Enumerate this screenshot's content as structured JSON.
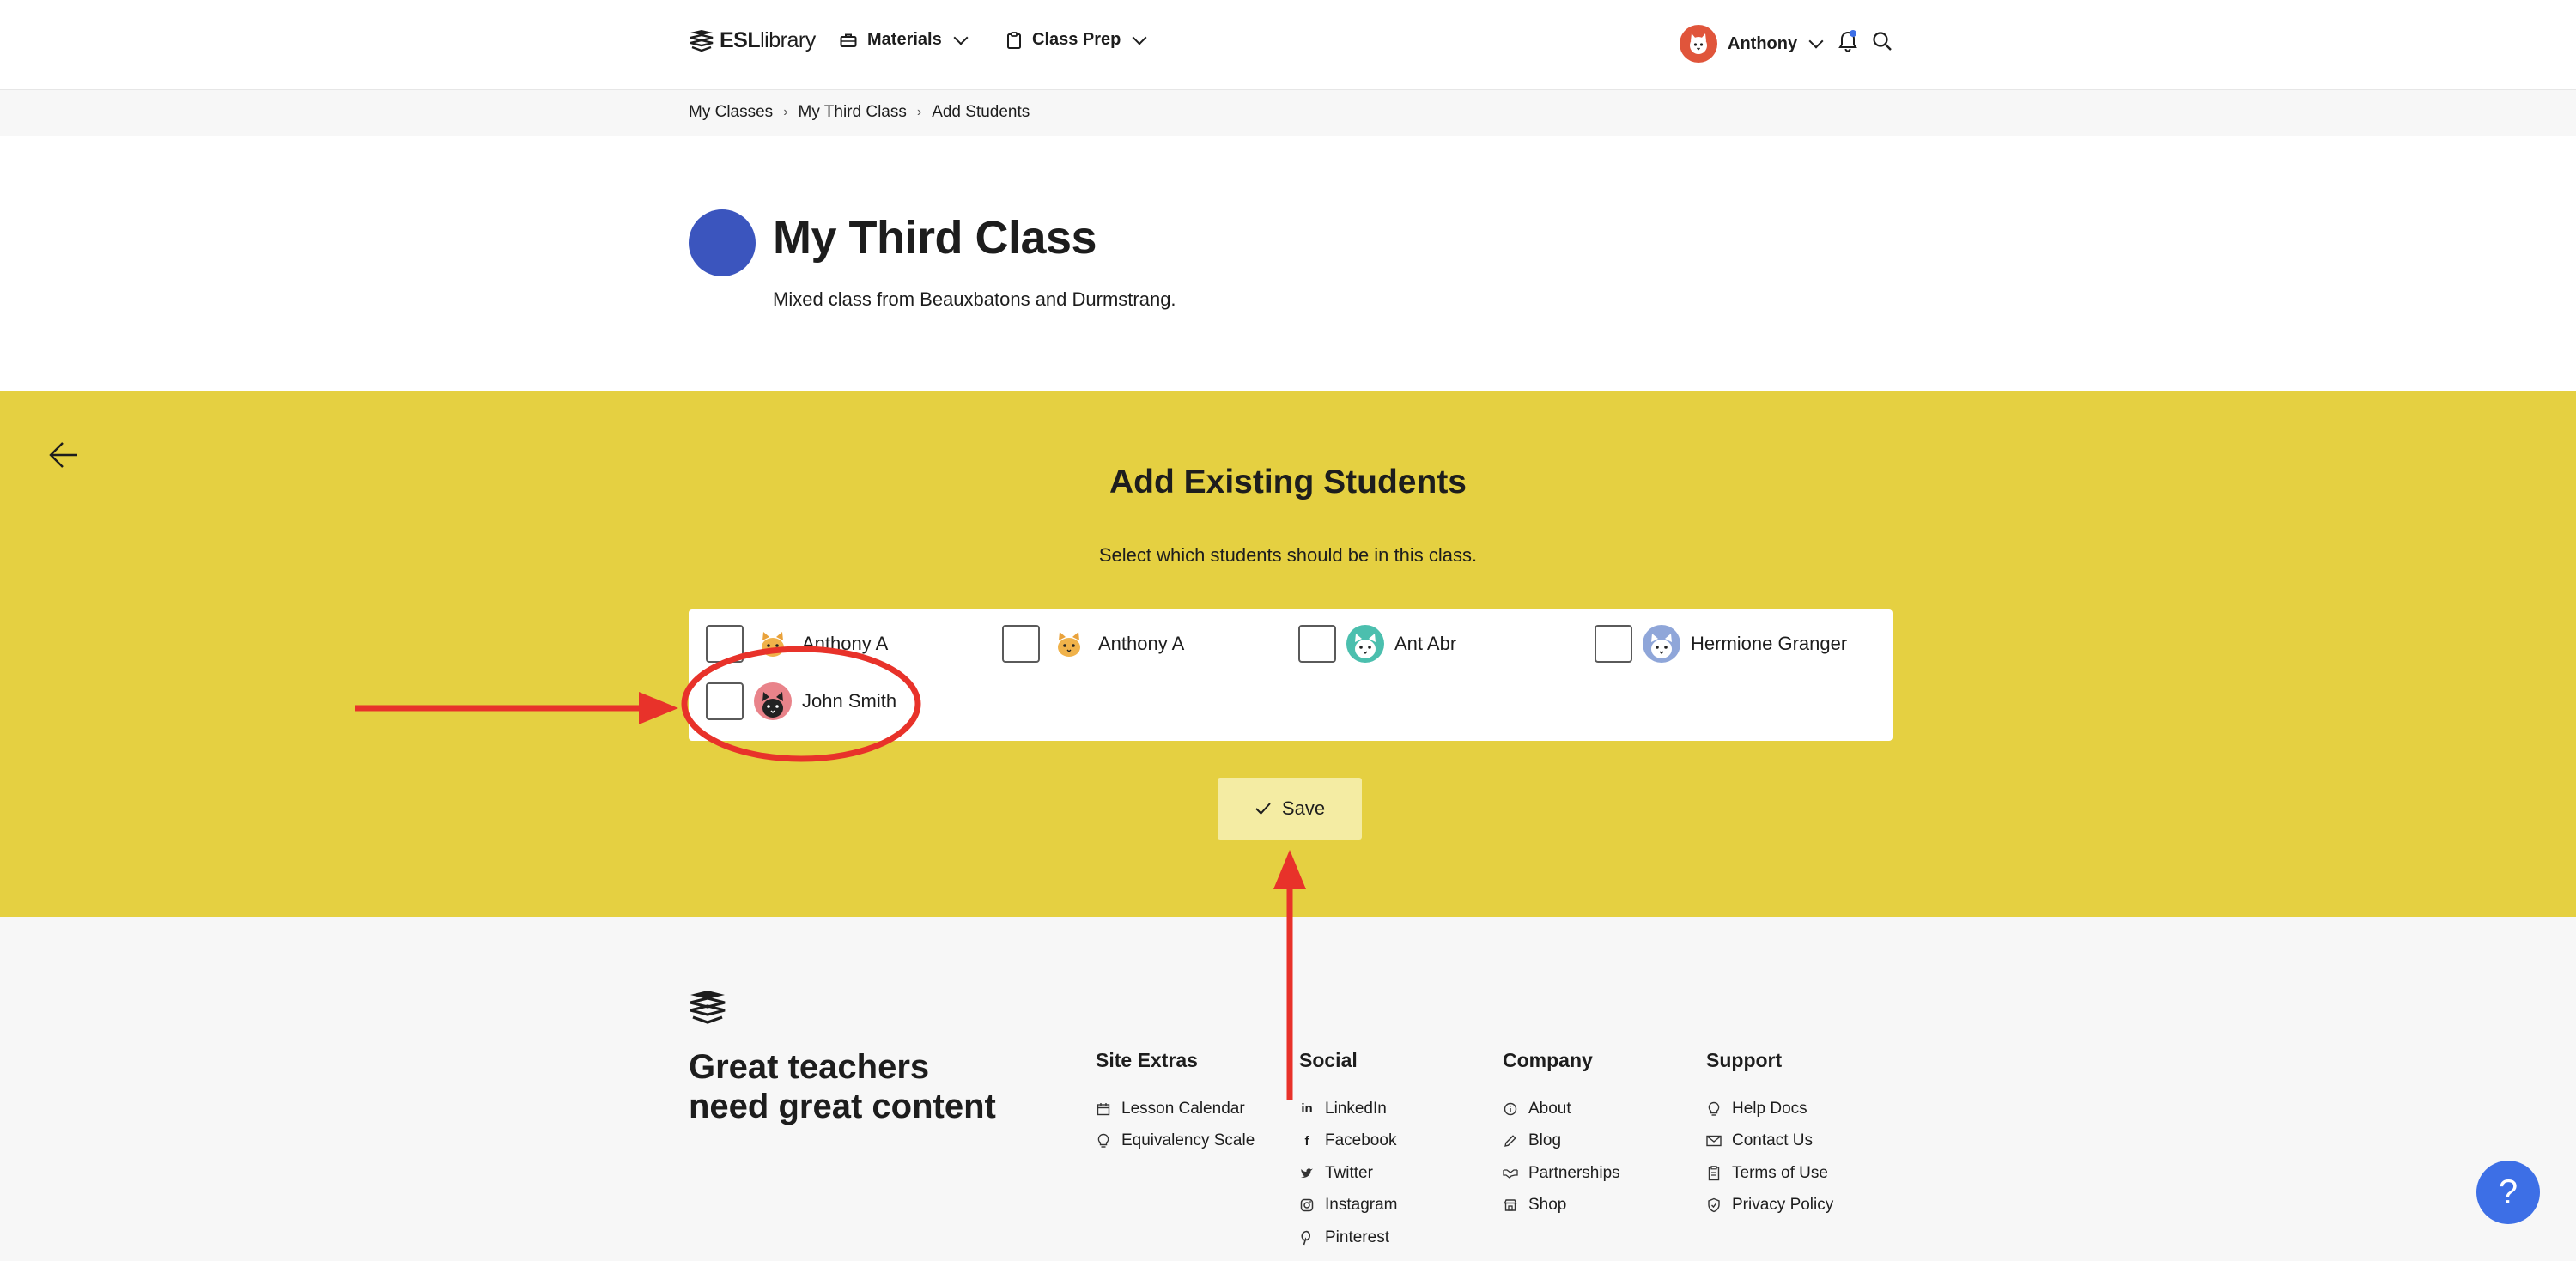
{
  "header": {
    "logo_bold": "ESL",
    "logo_rest": "library",
    "nav": [
      {
        "label": "Materials",
        "icon": "briefcase-icon"
      },
      {
        "label": "Class Prep",
        "icon": "clipboard-icon"
      }
    ],
    "user_name": "Anthony"
  },
  "breadcrumb": [
    "My Classes",
    "My Third Class",
    "Add Students"
  ],
  "class": {
    "title": "My Third Class",
    "description": "Mixed class from Beauxbatons and Durmstrang.",
    "color": "#3b55be"
  },
  "section": {
    "title": "Add Existing Students",
    "subtitle": "Select which students should be in this class.",
    "students": [
      {
        "name": "Anthony A",
        "avatar": "orange-cat",
        "checked": false
      },
      {
        "name": "Anthony A",
        "avatar": "orange-cat",
        "checked": false
      },
      {
        "name": "Ant Abr",
        "avatar": "teal-cat",
        "checked": false
      },
      {
        "name": "Hermione Granger",
        "avatar": "blue-cat",
        "checked": false
      },
      {
        "name": "John Smith",
        "avatar": "black-cat",
        "checked": false
      }
    ],
    "save_label": "Save",
    "background": "#e5d041"
  },
  "footer": {
    "tagline_line1": "Great teachers",
    "tagline_line2": "need great content",
    "columns": [
      {
        "title": "Site Extras",
        "links": [
          {
            "label": "Lesson Calendar",
            "icon": "calendar-icon"
          },
          {
            "label": "Equivalency Scale",
            "icon": "lightbulb-icon"
          }
        ]
      },
      {
        "title": "Social",
        "links": [
          {
            "label": "LinkedIn",
            "icon": "linkedin-icon"
          },
          {
            "label": "Facebook",
            "icon": "facebook-icon"
          },
          {
            "label": "Twitter",
            "icon": "twitter-icon"
          },
          {
            "label": "Instagram",
            "icon": "instagram-icon"
          },
          {
            "label": "Pinterest",
            "icon": "pinterest-icon"
          }
        ]
      },
      {
        "title": "Company",
        "links": [
          {
            "label": "About",
            "icon": "info-icon"
          },
          {
            "label": "Blog",
            "icon": "pencil-icon"
          },
          {
            "label": "Partnerships",
            "icon": "handshake-icon"
          },
          {
            "label": "Shop",
            "icon": "shop-icon"
          }
        ]
      },
      {
        "title": "Support",
        "links": [
          {
            "label": "Help Docs",
            "icon": "help-docs-icon"
          },
          {
            "label": "Contact Us",
            "icon": "envelope-icon"
          },
          {
            "label": "Terms of Use",
            "icon": "document-icon"
          },
          {
            "label": "Privacy Policy",
            "icon": "shield-icon"
          }
        ]
      }
    ],
    "help_label": "?"
  },
  "annotation_color": "#e8322a"
}
